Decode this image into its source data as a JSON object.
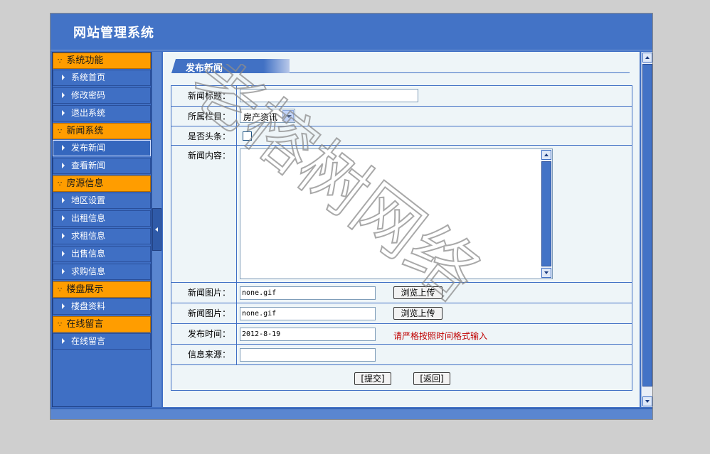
{
  "header": {
    "title": "网站管理系统"
  },
  "sidebar": {
    "groups": [
      {
        "title": "系统功能",
        "items": [
          "系统首页",
          "修改密码",
          "退出系统"
        ]
      },
      {
        "title": "新闻系统",
        "items": [
          "发布新闻",
          "查看新闻"
        ]
      },
      {
        "title": "房源信息",
        "items": [
          "地区设置",
          "出租信息",
          "求租信息",
          "出售信息",
          "求购信息"
        ]
      },
      {
        "title": "楼盘展示",
        "items": [
          "楼盘资料"
        ]
      },
      {
        "title": "在线留言",
        "items": [
          "在线留言"
        ]
      }
    ],
    "active_item": "发布新闻"
  },
  "page": {
    "tab_title": "发布新闻"
  },
  "form": {
    "title_label": "新闻标题：",
    "title_value": "",
    "category_label": "所属栏目：",
    "category_value": "房产资讯",
    "headline_label": "是否头条：",
    "headline_checked": false,
    "content_label": "新闻内容：",
    "content_value": "",
    "image1_label": "新闻图片：",
    "image1_value": "none.gif",
    "image1_button": "浏览上传",
    "image2_label": "新闻图片：",
    "image2_value": "none.gif",
    "image2_button": "浏览上传",
    "date_label": "发布时间：",
    "date_value": "2012-8-19",
    "date_hint": "请严格按照时间格式输入",
    "source_label": "信息来源：",
    "source_value": "",
    "submit_label": "[提交]",
    "back_label": "[返回]"
  },
  "watermark": {
    "text": "老榕树网络"
  },
  "colors": {
    "header_bg": "#4373c6",
    "section_bg": "#ff9d00",
    "hint": "#c00000"
  }
}
